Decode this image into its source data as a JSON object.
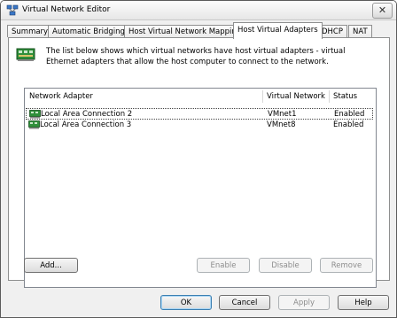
{
  "window": {
    "title": "Virtual Network Editor",
    "close_glyph": "✕"
  },
  "tabs": [
    {
      "label": "Summary"
    },
    {
      "label": "Automatic Bridging"
    },
    {
      "label": "Host Virtual Network Mapping"
    },
    {
      "label": "Host Virtual Adapters",
      "active": true
    },
    {
      "label": "DHCP"
    },
    {
      "label": "NAT"
    }
  ],
  "description": "The list below shows which virtual networks have host virtual adapters - virtual Ethernet adapters that allow the host computer to connect to the network.",
  "table": {
    "headers": [
      "Network Adapter",
      "Virtual Network",
      "Status"
    ],
    "rows": [
      {
        "adapter": "Local Area Connection 2",
        "network": "VMnet1",
        "status": "Enabled"
      },
      {
        "adapter": "Local Area Connection 3",
        "network": "VMnet8",
        "status": "Enabled"
      }
    ]
  },
  "panel_buttons": {
    "add": "Add...",
    "enable": "Enable",
    "disable": "Disable",
    "remove": "Remove"
  },
  "dialog_buttons": {
    "ok": "OK",
    "cancel": "Cancel",
    "apply": "Apply",
    "help": "Help"
  },
  "icons": {
    "app": "network-editor-icon",
    "info": "network-adapter-icon",
    "row": "network-adapter-icon"
  }
}
